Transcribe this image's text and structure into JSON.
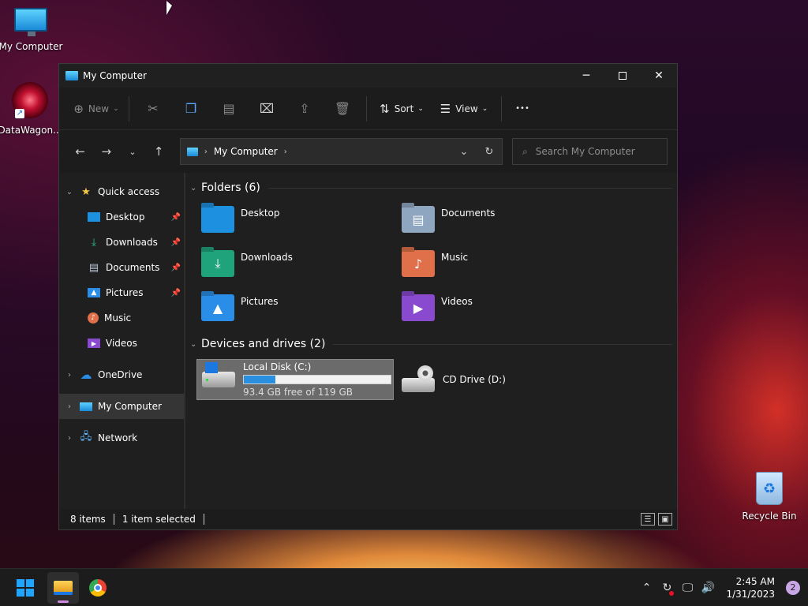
{
  "desktop": {
    "icons": [
      {
        "label": "My Computer"
      },
      {
        "label": "DataWagon..."
      },
      {
        "label": "Recycle Bin"
      }
    ]
  },
  "window": {
    "title": "My Computer",
    "controls": {
      "minimize": "─",
      "maximize": "□",
      "close": "✕"
    }
  },
  "toolbar": {
    "new_label": "New",
    "sort_label": "Sort",
    "view_label": "View",
    "more_label": "•••"
  },
  "nav": {
    "breadcrumb": "My Computer",
    "search_placeholder": "Search My Computer"
  },
  "sidebar": {
    "quick_access": "Quick access",
    "items": [
      {
        "label": "Desktop"
      },
      {
        "label": "Downloads"
      },
      {
        "label": "Documents"
      },
      {
        "label": "Pictures"
      },
      {
        "label": "Music"
      },
      {
        "label": "Videos"
      }
    ],
    "onedrive": "OneDrive",
    "my_computer": "My Computer",
    "network": "Network"
  },
  "content": {
    "folders_header": "Folders (6)",
    "folders": [
      {
        "name": "Desktop",
        "color": "#1e90e0"
      },
      {
        "name": "Documents",
        "color": "#8fa6c0"
      },
      {
        "name": "Downloads",
        "color": "#1fa37a"
      },
      {
        "name": "Music",
        "color": "#e0704a"
      },
      {
        "name": "Pictures",
        "color": "#2a8ee8"
      },
      {
        "name": "Videos",
        "color": "#8a4ad0"
      }
    ],
    "devices_header": "Devices and drives (2)",
    "drives": [
      {
        "name": "Local Disk (C:)",
        "free": "93.4 GB free of 119 GB",
        "used_fraction": 0.215
      },
      {
        "name": "CD Drive (D:)"
      }
    ]
  },
  "status": {
    "items": "8 items",
    "selected": "1 item selected"
  },
  "taskbar": {
    "time": "2:45 AM",
    "date": "1/31/2023",
    "notifications": "2"
  }
}
